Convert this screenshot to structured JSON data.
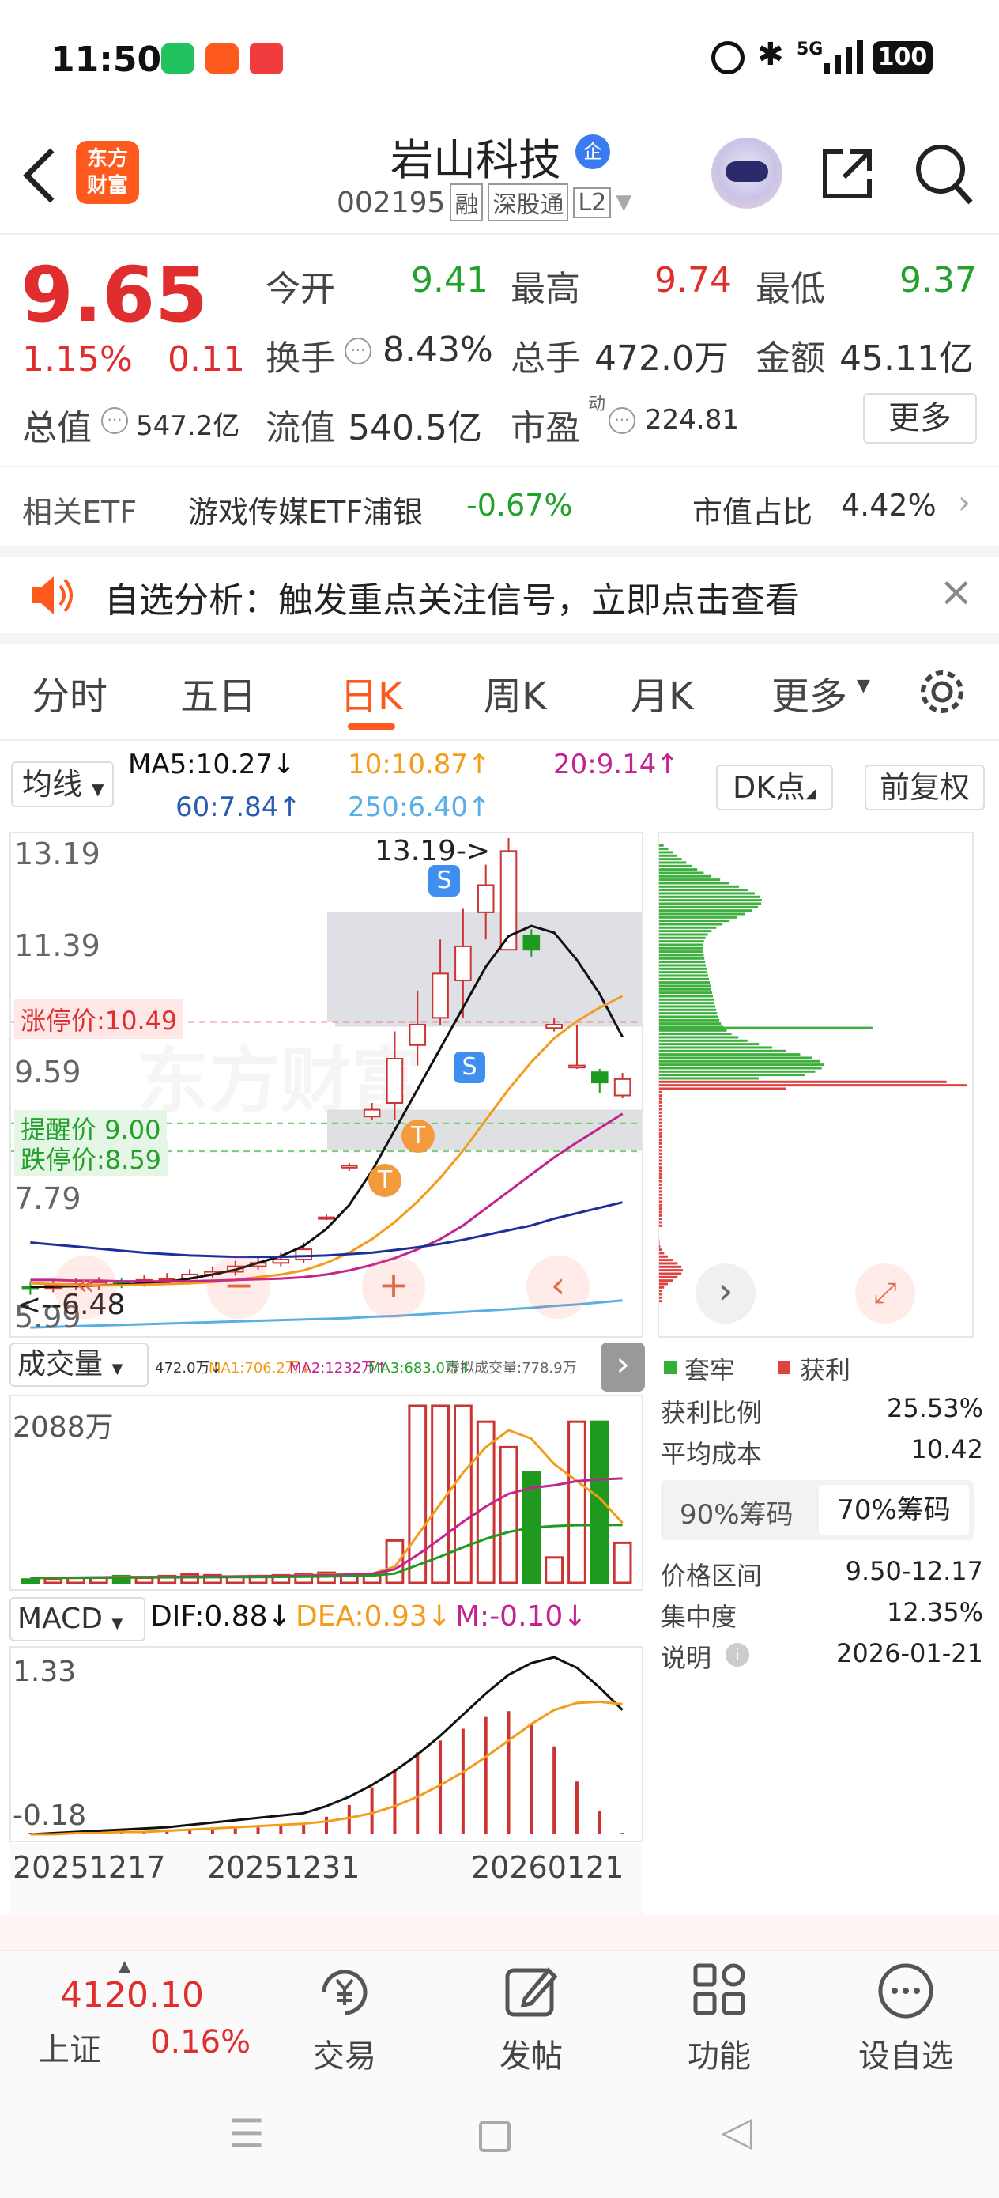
{
  "status_bar": {
    "time": "11:50",
    "battery": "100",
    "signal": "5G"
  },
  "header": {
    "title": "岩山科技",
    "title_badge": "企",
    "code": "002195",
    "badge_margin": "融",
    "badge_exchange": "深股通",
    "badge_level": "L2",
    "logo_line1": "东方",
    "logo_line2": "财富"
  },
  "quote": {
    "price": "9.65",
    "change_pct": "1.15%",
    "change": "0.11",
    "open_label": "今开",
    "open": "9.41",
    "high_label": "最高",
    "high": "9.74",
    "low_label": "最低",
    "low": "9.37",
    "turnover_label": "换手",
    "turnover": "8.43%",
    "volume_label": "总手",
    "volume": "472.0万",
    "amount_label": "金额",
    "amount": "45.11亿",
    "mcap_label": "总值",
    "mcap": "547.2亿",
    "float_label": "流值",
    "float": "540.5亿",
    "pe_label": "市盈",
    "pe_sup": "动",
    "pe": "224.81",
    "more_button": "更多"
  },
  "etf": {
    "label": "相关ETF",
    "name": "游戏传媒ETF浦银",
    "change": "-0.67%",
    "ratio_label": "市值占比",
    "ratio": "4.42%"
  },
  "notice": {
    "text": "自选分析：触发重点关注信号，立即点击查看"
  },
  "tabs": [
    "分时",
    "五日",
    "日K",
    "周K",
    "月K",
    "更多"
  ],
  "active_tab": 2,
  "ma_bar": {
    "selector": "均线",
    "ma5": "MA5:10.27↓",
    "ma10": "10:10.87↑",
    "ma20": "20:9.14↑",
    "ma60": "60:7.84↑",
    "ma250": "250:6.40↑",
    "dk": "DK点",
    "adjust": "前复权"
  },
  "kline": {
    "y_labels": [
      "13.19",
      "11.39",
      "9.59",
      "7.79",
      "5.99"
    ],
    "max_label": "13.19->",
    "min_label": "<--6.48",
    "limit_up": "涨停价:10.49",
    "alert": "提醒价 9.00",
    "limit_down": "跌停价:8.59",
    "signal_s": "S",
    "signal_t": "T",
    "watermark": "东方财富"
  },
  "volume": {
    "selector": "成交量",
    "v": "472.0万↓",
    "ma1": "MA1:706.2万↓",
    "ma2": "MA2:1232万↑",
    "ma3": "MA3:683.0万↑",
    "virtual": "虚拟成交量:778.9万",
    "y_top": "2088万"
  },
  "macd": {
    "selector": "MACD",
    "dif": "DIF:0.88↓",
    "dea": "DEA:0.93↓",
    "m": "M:-0.10↓",
    "y_top": "1.33",
    "y_bottom": "-0.18"
  },
  "x_axis": [
    "20251217",
    "20251231",
    "20260121"
  ],
  "chips": {
    "legend_trap": "套牢",
    "legend_profit": "获利",
    "profit_ratio_label": "获利比例",
    "profit_ratio": "25.53%",
    "avg_cost_label": "平均成本",
    "avg_cost": "10.42",
    "tab90": "90%筹码",
    "tab70": "70%筹码",
    "range_label": "价格区间",
    "range": "9.50-12.17",
    "conc_label": "集中度",
    "conc": "12.35%",
    "note_label": "说明",
    "note_date": "2026-01-21"
  },
  "bottom_nav": {
    "index_value": "4120.10",
    "index_name": "上证",
    "index_change": "0.16%",
    "trade": "交易",
    "post": "发帖",
    "func": "功能",
    "watch": "设自选"
  },
  "colors": {
    "up": "#e02e2e",
    "down": "#22a22a",
    "accent": "#ff6b1a",
    "ma5": "#111111",
    "ma10": "#f39c1a",
    "ma20": "#c2238f",
    "ma60": "#1f2f9a",
    "ma250": "#5aaee6"
  },
  "chart_data": [
    {
      "type": "candlestick",
      "title": "日K",
      "ylim": [
        5.99,
        13.19
      ],
      "x_ticks": [
        "20251217",
        "20251231",
        "20260121"
      ],
      "candles": [
        {
          "o": 6.6,
          "c": 6.58,
          "h": 6.68,
          "l": 6.48
        },
        {
          "o": 6.58,
          "c": 6.62,
          "h": 6.7,
          "l": 6.52
        },
        {
          "o": 6.6,
          "c": 6.64,
          "h": 6.72,
          "l": 6.55
        },
        {
          "o": 6.62,
          "c": 6.66,
          "h": 6.74,
          "l": 6.56
        },
        {
          "o": 6.66,
          "c": 6.63,
          "h": 6.72,
          "l": 6.58
        },
        {
          "o": 6.63,
          "c": 6.7,
          "h": 6.78,
          "l": 6.6
        },
        {
          "o": 6.7,
          "c": 6.72,
          "h": 6.8,
          "l": 6.64
        },
        {
          "o": 6.72,
          "c": 6.78,
          "h": 6.86,
          "l": 6.68
        },
        {
          "o": 6.78,
          "c": 6.82,
          "h": 6.9,
          "l": 6.72
        },
        {
          "o": 6.82,
          "c": 6.9,
          "h": 6.98,
          "l": 6.76
        },
        {
          "o": 6.9,
          "c": 6.95,
          "h": 7.05,
          "l": 6.85
        },
        {
          "o": 6.95,
          "c": 7.0,
          "h": 7.1,
          "l": 6.9
        },
        {
          "o": 7.0,
          "c": 7.15,
          "h": 7.25,
          "l": 6.95
        },
        {
          "o": 7.6,
          "c": 7.62,
          "h": 7.66,
          "l": 7.58
        },
        {
          "o": 8.35,
          "c": 8.38,
          "h": 8.42,
          "l": 8.3
        },
        {
          "o": 9.1,
          "c": 9.2,
          "h": 9.3,
          "l": 9.05
        },
        {
          "o": 9.3,
          "c": 9.95,
          "h": 10.35,
          "l": 9.05
        },
        {
          "o": 10.15,
          "c": 10.45,
          "h": 10.95,
          "l": 9.85
        },
        {
          "o": 10.55,
          "c": 11.2,
          "h": 11.7,
          "l": 10.45
        },
        {
          "o": 11.1,
          "c": 11.6,
          "h": 12.15,
          "l": 10.55
        },
        {
          "o": 12.1,
          "c": 12.5,
          "h": 12.8,
          "l": 11.7
        },
        {
          "o": 11.55,
          "c": 13.0,
          "h": 13.19,
          "l": 11.55
        },
        {
          "o": 11.75,
          "c": 11.55,
          "h": 11.85,
          "l": 11.45
        },
        {
          "o": 10.4,
          "c": 10.45,
          "h": 10.55,
          "l": 10.35
        },
        {
          "o": 9.82,
          "c": 9.85,
          "h": 10.45,
          "l": 9.8
        },
        {
          "o": 9.75,
          "c": 9.6,
          "h": 9.8,
          "l": 9.45
        },
        {
          "o": 9.41,
          "c": 9.65,
          "h": 9.74,
          "l": 9.37
        }
      ],
      "ma_lines": [
        {
          "name": "MA5",
          "values": [
            6.6,
            6.6,
            6.61,
            6.62,
            6.63,
            6.65,
            6.67,
            6.72,
            6.78,
            6.85,
            6.95,
            7.05,
            7.2,
            7.45,
            7.8,
            8.3,
            8.9,
            9.5,
            10.1,
            10.7,
            11.3,
            11.75,
            11.9,
            11.8,
            11.4,
            10.9,
            10.27
          ]
        },
        {
          "name": "MA10",
          "values": [
            6.65,
            6.64,
            6.63,
            6.62,
            6.62,
            6.63,
            6.64,
            6.65,
            6.67,
            6.7,
            6.74,
            6.78,
            6.84,
            6.95,
            7.1,
            7.3,
            7.55,
            7.85,
            8.2,
            8.6,
            9.05,
            9.5,
            9.9,
            10.25,
            10.5,
            10.7,
            10.87
          ]
        },
        {
          "name": "MA20",
          "values": [
            6.7,
            6.7,
            6.69,
            6.69,
            6.68,
            6.68,
            6.68,
            6.68,
            6.69,
            6.7,
            6.71,
            6.72,
            6.74,
            6.78,
            6.84,
            6.92,
            7.02,
            7.15,
            7.3,
            7.5,
            7.75,
            8.0,
            8.25,
            8.5,
            8.72,
            8.93,
            9.14
          ]
        },
        {
          "name": "MA60",
          "values": [
            7.25,
            7.22,
            7.19,
            7.16,
            7.13,
            7.1,
            7.08,
            7.06,
            7.05,
            7.04,
            7.04,
            7.04,
            7.05,
            7.06,
            7.08,
            7.1,
            7.14,
            7.18,
            7.23,
            7.29,
            7.36,
            7.43,
            7.5,
            7.6,
            7.68,
            7.76,
            7.84
          ]
        },
        {
          "name": "MA250",
          "values": [
            6.0,
            6.01,
            6.02,
            6.03,
            6.04,
            6.05,
            6.06,
            6.07,
            6.08,
            6.09,
            6.1,
            6.11,
            6.12,
            6.13,
            6.14,
            6.16,
            6.17,
            6.19,
            6.21,
            6.23,
            6.25,
            6.27,
            6.29,
            6.32,
            6.34,
            6.37,
            6.4
          ]
        }
      ]
    },
    {
      "type": "bar",
      "title": "成交量",
      "ylim": [
        0,
        2088
      ],
      "values": [
        40,
        50,
        60,
        60,
        80,
        60,
        80,
        100,
        90,
        70,
        80,
        90,
        100,
        120,
        100,
        100,
        500,
        2088,
        2088,
        2088,
        1900,
        1600,
        1300,
        300,
        1900,
        1900,
        472
      ],
      "series": [
        {
          "name": "MA1",
          "values": [
            60,
            60,
            60,
            65,
            70,
            70,
            70,
            70,
            72,
            76,
            80,
            82,
            88,
            96,
            104,
            108,
            190,
            560,
            930,
            1300,
            1600,
            1800,
            1700,
            1400,
            1200,
            1000,
            706
          ]
        },
        {
          "name": "MA2",
          "values": [
            60,
            60,
            62,
            64,
            66,
            68,
            70,
            72,
            74,
            76,
            78,
            80,
            85,
            90,
            98,
            105,
            160,
            330,
            520,
            720,
            900,
            1050,
            1120,
            1150,
            1200,
            1220,
            1232
          ]
        },
        {
          "name": "MA3",
          "values": [
            60,
            60,
            60,
            61,
            62,
            63,
            64,
            65,
            66,
            67,
            68,
            70,
            72,
            75,
            80,
            85,
            110,
            210,
            310,
            420,
            520,
            600,
            650,
            670,
            680,
            682,
            683
          ]
        }
      ]
    },
    {
      "type": "bar",
      "title": "MACD",
      "ylim": [
        -0.18,
        1.33
      ],
      "values": [
        0.005,
        0.01,
        0.015,
        0.02,
        0.025,
        0.03,
        0.035,
        0.04,
        0.045,
        0.05,
        0.06,
        0.07,
        0.08,
        0.15,
        0.25,
        0.4,
        0.55,
        0.7,
        0.8,
        0.9,
        1.0,
        1.05,
        0.95,
        0.75,
        0.45,
        0.2,
        -0.1
      ],
      "series": [
        {
          "name": "DIF",
          "values": [
            -0.18,
            -0.17,
            -0.16,
            -0.15,
            -0.14,
            -0.13,
            -0.12,
            -0.1,
            -0.08,
            -0.06,
            -0.04,
            -0.02,
            0.0,
            0.06,
            0.14,
            0.24,
            0.36,
            0.5,
            0.66,
            0.84,
            1.02,
            1.18,
            1.28,
            1.33,
            1.24,
            1.07,
            0.88
          ]
        },
        {
          "name": "DEA",
          "values": [
            -0.18,
            -0.18,
            -0.17,
            -0.17,
            -0.16,
            -0.16,
            -0.15,
            -0.14,
            -0.13,
            -0.12,
            -0.11,
            -0.1,
            -0.09,
            -0.07,
            -0.04,
            0.0,
            0.06,
            0.14,
            0.24,
            0.35,
            0.48,
            0.62,
            0.76,
            0.88,
            0.94,
            0.95,
            0.93
          ]
        }
      ]
    }
  ]
}
